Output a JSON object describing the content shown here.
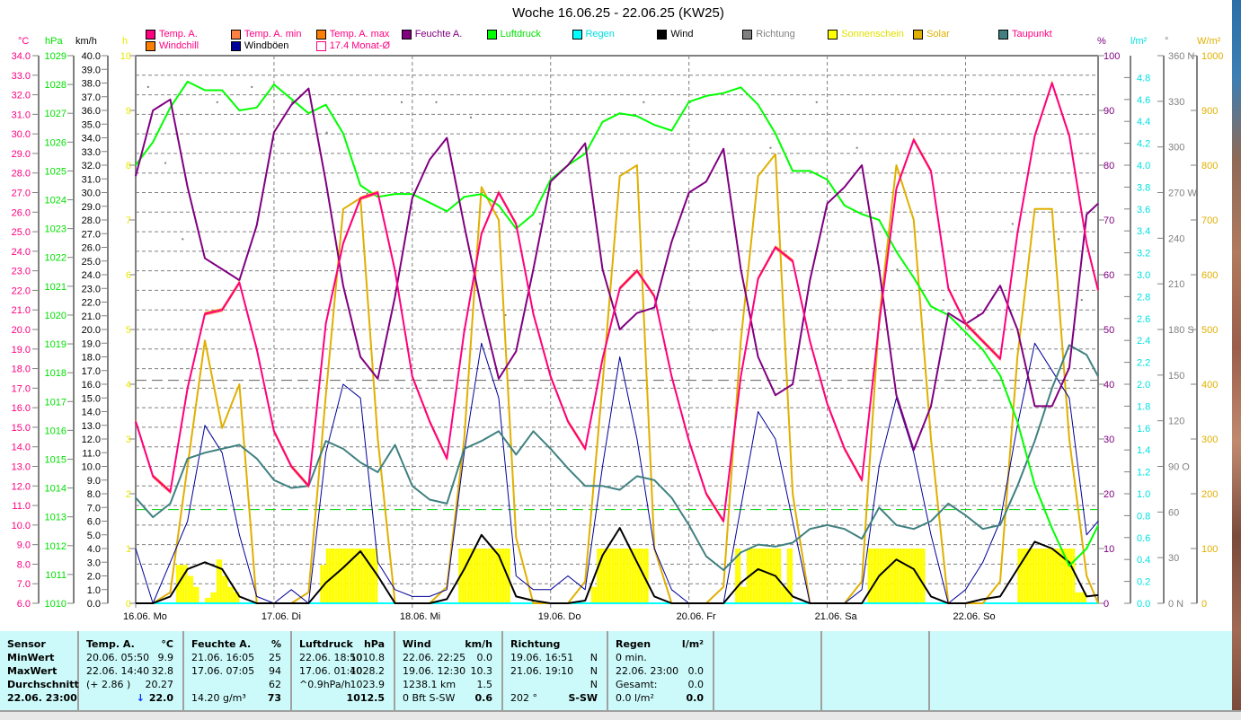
{
  "title": "Woche 16.06.25 - 22.06.25 (KW25)",
  "legend": [
    {
      "label": "Temp. A.",
      "color": "#ff0080",
      "text_color": "#ff0080"
    },
    {
      "label": "Temp. A. min",
      "color": "#ff8040",
      "text_color": "#ff0080"
    },
    {
      "label": "Temp. A. max",
      "color": "#ff8000",
      "text_color": "#ff0080"
    },
    {
      "label": "Feuchte A.",
      "color": "#800080",
      "text_color": "#800080"
    },
    {
      "label": "Luftdruck",
      "color": "#00ff00",
      "text_color": "#00e000"
    },
    {
      "label": "Regen",
      "color": "#00ffff",
      "text_color": "#00e0e0"
    },
    {
      "label": "Wind",
      "color": "#000000",
      "text_color": "#000000"
    },
    {
      "label": "Richtung",
      "color": "#808080",
      "text_color": "#808080"
    },
    {
      "label": "Sonnenschein",
      "color": "#ffff00",
      "text_color": "#e0e000"
    },
    {
      "label": "Solar",
      "color": "#e0b000",
      "text_color": "#e0b000"
    },
    {
      "label": "Taupunkt",
      "color": "#408080",
      "text_color": "#ff0080"
    },
    {
      "label": "Windchill",
      "color": "#ff8000",
      "text_color": "#ff0080"
    },
    {
      "label": "Windböen",
      "color": "#000099",
      "text_color": "#000000"
    },
    {
      "label": "17.4 Monat-Ø",
      "color": "#ffffff",
      "text_color": "#ff0080"
    }
  ],
  "units": {
    "temp": "°C",
    "pressure": "hPa",
    "wind": "km/h",
    "sun": "h",
    "humidity": "%",
    "rain": "l/m²",
    "direction": "°",
    "solar": "W/m²"
  },
  "chart_data": {
    "type": "line",
    "title": "Woche 16.06.25 - 22.06.25 (KW25)",
    "x_days": [
      "16.06.  Mo",
      "17.06.  Di",
      "18.06.  Mi",
      "19.06.  Do",
      "20.06.  Fr",
      "21.06.  Sa",
      "22.06.  So"
    ],
    "x_range_hours": [
      0,
      167
    ],
    "step_hours": 3,
    "axes": {
      "temp": {
        "min": 6,
        "max": 34,
        "step": 1,
        "decimals": 1,
        "color": "#ff0080"
      },
      "pressure": {
        "min": 1010,
        "max": 1029,
        "step": 1,
        "decimals": 0,
        "color": "#00e000"
      },
      "wind": {
        "min": 0,
        "max": 40,
        "step": 1,
        "decimals": 1,
        "color": "#000000"
      },
      "sun": {
        "min": 0,
        "max": 10,
        "step": 1,
        "decimals": 0,
        "color": "#e8e800"
      },
      "humidity": {
        "min": 0,
        "max": 100,
        "step": 10,
        "decimals": 0,
        "color": "#800080"
      },
      "rain": {
        "min": 0,
        "max": 5.0,
        "step": 0.2,
        "label_max": 4.8,
        "decimals": 1,
        "color": "#00e0e0"
      },
      "direction": {
        "min": 0,
        "max": 360,
        "step": 30,
        "decimals": 0,
        "color": "#808080",
        "compass": {
          "0": "N",
          "90": "O",
          "180": "S",
          "270": "W",
          "360": "N"
        }
      },
      "solar": {
        "min": 0,
        "max": 1000,
        "step": 100,
        "decimals": 0,
        "color": "#e0b000"
      }
    },
    "reference_lines": {
      "temp_month_avg": 17.4,
      "pressure_standard": 1013.25
    },
    "series": [
      {
        "name": "Temp. A.",
        "axis": "temp",
        "color": "#ff0080",
        "values": [
          15.3,
          12.5,
          11.7,
          17.0,
          20.8,
          21.0,
          22.4,
          19.0,
          14.8,
          13.0,
          12.0,
          20.3,
          24.4,
          26.7,
          27.0,
          23.0,
          17.6,
          15.3,
          13.4,
          19.9,
          24.9,
          27.0,
          25.4,
          20.8,
          17.6,
          15.3,
          13.9,
          18.5,
          22.1,
          23.0,
          21.7,
          17.6,
          14.3,
          11.6,
          10.2,
          17.6,
          22.6,
          24.2,
          23.5,
          19.4,
          16.2,
          13.9,
          12.3,
          20.3,
          27.2,
          29.7,
          28.1,
          22.1,
          20.3,
          19.4,
          18.5,
          24.9,
          29.9,
          32.6,
          29.9,
          24.4,
          22.0
        ]
      },
      {
        "name": "Feuchte A.",
        "axis": "humidity",
        "color": "#800080",
        "values": [
          78,
          90,
          92,
          76,
          63,
          61,
          59,
          69,
          86,
          91,
          94,
          77,
          58,
          45,
          41,
          56,
          74,
          81,
          85,
          69,
          54,
          41,
          46,
          61,
          77,
          80,
          84,
          61,
          50,
          53,
          54,
          66,
          75,
          77,
          83,
          61,
          45,
          38,
          40,
          59,
          73,
          76,
          80,
          61,
          38,
          28,
          36,
          53,
          51,
          53,
          58,
          50,
          36,
          36,
          43,
          71,
          73
        ]
      },
      {
        "name": "Luftdruck",
        "axis": "pressure",
        "color": "#00ff00",
        "values": [
          1025.2,
          1026.0,
          1027.2,
          1028.1,
          1027.8,
          1027.8,
          1027.1,
          1027.2,
          1028.0,
          1027.5,
          1027.0,
          1027.3,
          1026.3,
          1024.5,
          1024.1,
          1024.2,
          1024.2,
          1023.9,
          1023.6,
          1024.1,
          1024.2,
          1023.8,
          1023.0,
          1023.5,
          1024.7,
          1025.2,
          1025.6,
          1026.7,
          1027.0,
          1026.9,
          1026.6,
          1026.4,
          1027.4,
          1027.6,
          1027.7,
          1027.9,
          1027.3,
          1026.3,
          1025.0,
          1025.0,
          1024.7,
          1023.8,
          1023.5,
          1023.3,
          1022.2,
          1021.3,
          1020.3,
          1020.0,
          1019.4,
          1018.8,
          1017.9,
          1016.3,
          1014.1,
          1012.6,
          1011.3,
          1011.9,
          1012.7
        ]
      },
      {
        "name": "Taupunkt",
        "axis": "temp",
        "color": "#408080",
        "values": [
          11.4,
          10.4,
          11.1,
          13.4,
          13.7,
          13.9,
          14.1,
          13.4,
          12.3,
          11.9,
          12.0,
          14.3,
          13.9,
          13.2,
          12.7,
          14.1,
          12.0,
          11.3,
          11.1,
          13.9,
          14.3,
          14.8,
          13.6,
          14.8,
          13.9,
          12.9,
          12.0,
          12.0,
          11.8,
          12.5,
          12.3,
          11.4,
          10.0,
          8.4,
          7.7,
          8.6,
          9.0,
          8.9,
          9.1,
          9.8,
          10.0,
          9.8,
          9.3,
          10.9,
          10.0,
          9.8,
          10.2,
          11.1,
          10.5,
          9.8,
          10.0,
          12.0,
          14.3,
          17.0,
          19.2,
          18.7,
          17.6
        ]
      },
      {
        "name": "Solar",
        "axis": "solar",
        "color": "#e0b000",
        "values": [
          0,
          0,
          20,
          250,
          480,
          320,
          400,
          0,
          0,
          0,
          20,
          380,
          720,
          740,
          300,
          0,
          0,
          0,
          30,
          300,
          760,
          700,
          120,
          0,
          0,
          0,
          40,
          400,
          780,
          800,
          100,
          0,
          0,
          0,
          30,
          480,
          780,
          820,
          200,
          0,
          0,
          0,
          40,
          520,
          800,
          700,
          300,
          0,
          0,
          0,
          40,
          450,
          720,
          720,
          300,
          50,
          0
        ]
      },
      {
        "name": "Wind",
        "axis": "wind",
        "color": "#000000",
        "values": [
          0,
          0,
          0.5,
          2.5,
          3.0,
          2.5,
          0.5,
          0,
          0,
          0,
          0,
          1.5,
          2.6,
          3.8,
          2.0,
          0,
          0,
          0,
          0.3,
          2.5,
          5.0,
          3.5,
          0.5,
          0.2,
          0,
          0,
          0.2,
          3.5,
          5.5,
          3.0,
          0.5,
          0,
          0,
          0,
          0,
          1.5,
          2.5,
          2.0,
          0.5,
          0,
          0,
          0,
          0,
          2.0,
          3.2,
          2.5,
          0.5,
          0,
          0,
          0.3,
          0.5,
          2.5,
          4.5,
          4.0,
          3.0,
          0.5,
          0.6
        ]
      },
      {
        "name": "Windböen",
        "axis": "wind",
        "color": "#000099",
        "values": [
          4,
          0,
          3,
          6,
          13,
          11,
          5,
          0.5,
          0,
          1,
          0,
          11,
          16,
          15,
          3,
          1,
          0.5,
          0.5,
          1,
          11,
          19,
          15,
          2,
          1,
          1,
          2,
          1,
          10,
          18,
          12,
          4,
          1,
          0,
          0,
          0,
          7,
          14,
          12,
          6,
          0,
          0,
          0,
          1,
          10,
          15,
          11,
          5,
          0,
          1,
          3,
          6,
          13,
          19,
          17,
          15,
          5,
          6
        ]
      },
      {
        "name": "Regen",
        "axis": "rain",
        "color": "#00ffff",
        "values": [
          0,
          0,
          0,
          0,
          0,
          0,
          0,
          0,
          0,
          0,
          0,
          0,
          0,
          0,
          0,
          0,
          0,
          0,
          0,
          0,
          0,
          0,
          0,
          0,
          0,
          0,
          0,
          0,
          0,
          0,
          0,
          0,
          0,
          0,
          0,
          0,
          0,
          0,
          0,
          0,
          0,
          0,
          0,
          0,
          0,
          0,
          0,
          0,
          0,
          0,
          0,
          0,
          0,
          0,
          0,
          0,
          0
        ]
      }
    ],
    "sunshine_hourly": [
      [
        0,
        0,
        0,
        0,
        0,
        0,
        0,
        0.7,
        0.7,
        0.5,
        0.3,
        0,
        0.1,
        0.2,
        0.8,
        0.5,
        0.3,
        0.2,
        0,
        0,
        0,
        0,
        0,
        0
      ],
      [
        0,
        0,
        0,
        0,
        0,
        0,
        0,
        0,
        0.7,
        1,
        1,
        1,
        1,
        1,
        1,
        1,
        1,
        1,
        0,
        0,
        0,
        0,
        0,
        0
      ],
      [
        0,
        0,
        0,
        0,
        0,
        0,
        0,
        0,
        1,
        1,
        1,
        1,
        1,
        1,
        1,
        1,
        1,
        0,
        0,
        0,
        0,
        0,
        0,
        0
      ],
      [
        0,
        0,
        0,
        0,
        0,
        0,
        0,
        0.3,
        1,
        1,
        1,
        1,
        1,
        1,
        1,
        1,
        1,
        0,
        0,
        0,
        0,
        0,
        0,
        0
      ],
      [
        0,
        0,
        0,
        0,
        0,
        0,
        0,
        0,
        1,
        0.3,
        1,
        1,
        1,
        1,
        1,
        1,
        0.3,
        1,
        0,
        0,
        0,
        0,
        0,
        0
      ],
      [
        0,
        0,
        0,
        0,
        0,
        0,
        0,
        1,
        1,
        1,
        1,
        1,
        1,
        1,
        1,
        1,
        1,
        0,
        0,
        0,
        0,
        0,
        0,
        0
      ],
      [
        0,
        0,
        0,
        0,
        0,
        0,
        0,
        0,
        0,
        1,
        1,
        1,
        1,
        1,
        1,
        1,
        1,
        1,
        1,
        0.2,
        0.2,
        0,
        0,
        0
      ]
    ],
    "direction_points": [
      [
        2,
        340
      ],
      [
        5,
        290
      ],
      [
        8,
        240
      ],
      [
        14,
        330
      ],
      [
        20,
        340
      ],
      [
        27,
        330
      ],
      [
        33,
        310
      ],
      [
        40,
        270
      ],
      [
        46,
        330
      ],
      [
        52,
        330
      ],
      [
        58,
        320
      ],
      [
        64,
        190
      ],
      [
        70,
        250
      ],
      [
        78,
        300
      ],
      [
        88,
        330
      ],
      [
        96,
        330
      ],
      [
        100,
        180
      ],
      [
        110,
        300
      ],
      [
        118,
        330
      ],
      [
        125,
        300
      ],
      [
        132,
        220
      ],
      [
        140,
        200
      ],
      [
        146,
        190
      ],
      [
        152,
        250
      ],
      [
        160,
        240
      ],
      [
        164,
        200
      ]
    ]
  },
  "stats": {
    "columns": [
      {
        "header": "Sensor",
        "unit": "",
        "rows": [
          [
            "MinWert",
            ""
          ],
          [
            "MaxWert",
            ""
          ],
          [
            "Durchschnitt",
            ""
          ],
          [
            "22.06.  23:00",
            ""
          ]
        ]
      },
      {
        "header": "Temp. A.",
        "unit": "°C",
        "rows": [
          [
            "20.06.  05:50",
            "9.9"
          ],
          [
            "22.06.  14:40",
            "32.8"
          ],
          [
            "(+ 2.86 )",
            "20.27"
          ],
          [
            "",
            "22.0"
          ]
        ],
        "current_trend": "↓"
      },
      {
        "header": "Feuchte A.",
        "unit": "%",
        "rows": [
          [
            "21.06.  16:05",
            "25"
          ],
          [
            "17.06.  07:05",
            "94"
          ],
          [
            "",
            "62"
          ],
          [
            "14.20 g/m³",
            "73"
          ]
        ]
      },
      {
        "header": "Luftdruck",
        "unit": "hPa",
        "rows": [
          [
            "22.06.  18:50",
            "1010.8"
          ],
          [
            "17.06.  01:40",
            "1028.2"
          ],
          [
            "^0.9hPa/h",
            "1023.9"
          ],
          [
            "",
            "1012.5"
          ]
        ]
      },
      {
        "header": "Wind",
        "unit": "km/h",
        "rows": [
          [
            "22.06.  22:25",
            "0.0"
          ],
          [
            "19.06.  12:30",
            "10.3"
          ],
          [
            "1238.1 km",
            "1.5"
          ],
          [
            "0 Bft S-SW",
            "0.6"
          ]
        ]
      },
      {
        "header": "Richtung",
        "unit": "",
        "rows": [
          [
            "19.06.  16:51",
            "N"
          ],
          [
            "21.06.  19:10",
            "N"
          ],
          [
            "",
            "N"
          ],
          [
            "202 °",
            "S-SW"
          ]
        ]
      },
      {
        "header": "Regen",
        "unit": "l/m²",
        "rows": [
          [
            "0 min.",
            ""
          ],
          [
            "22.06.  23:00",
            "0.0"
          ],
          [
            "Gesamt:",
            "0.0"
          ],
          [
            "0.0 l/m²",
            "0.0"
          ]
        ]
      }
    ]
  }
}
